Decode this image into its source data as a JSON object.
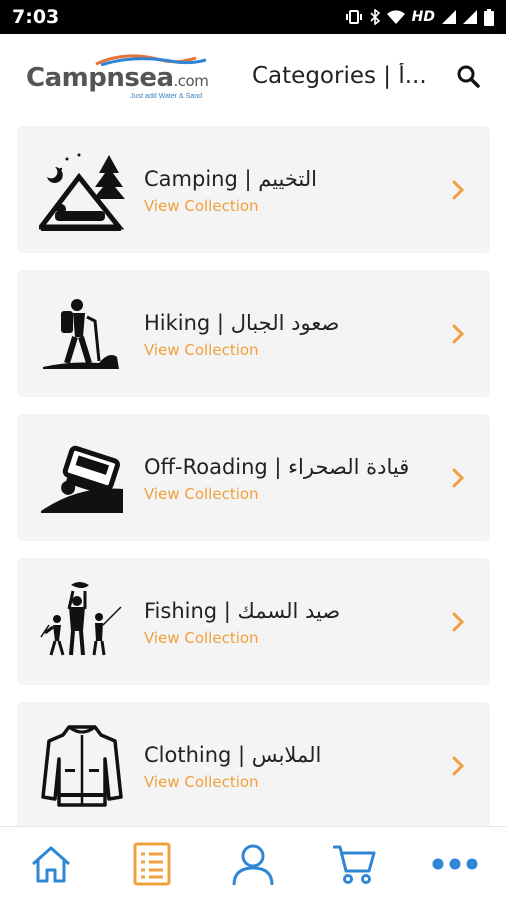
{
  "status_bar": {
    "time": "7:03",
    "network": "HD"
  },
  "header": {
    "logo_text": "Campnsea",
    "logo_suffix": ".com",
    "logo_tagline": "Just add Water & Sand",
    "title": "Categories | أ..."
  },
  "categories": [
    {
      "name": "Camping | التخييم",
      "link": "View Collection",
      "icon": "camping-tent-icon"
    },
    {
      "name": "Hiking | صعود الجبال",
      "link": "View Collection",
      "icon": "hiker-icon"
    },
    {
      "name": "Off-Roading | قيادة الصحراء",
      "link": "View Collection",
      "icon": "offroad-jeep-icon"
    },
    {
      "name": "Fishing | صيد السمك",
      "link": "View Collection",
      "icon": "fishing-icon"
    },
    {
      "name": "Clothing | الملابس",
      "link": "View Collection",
      "icon": "jacket-icon"
    }
  ],
  "bottom_nav": [
    "home-icon",
    "categories-list-icon",
    "profile-icon",
    "cart-icon",
    "more-icon"
  ],
  "colors": {
    "accent": "#f0a03c",
    "nav_blue": "#2f86d4",
    "card_bg": "#f4f4f4"
  }
}
